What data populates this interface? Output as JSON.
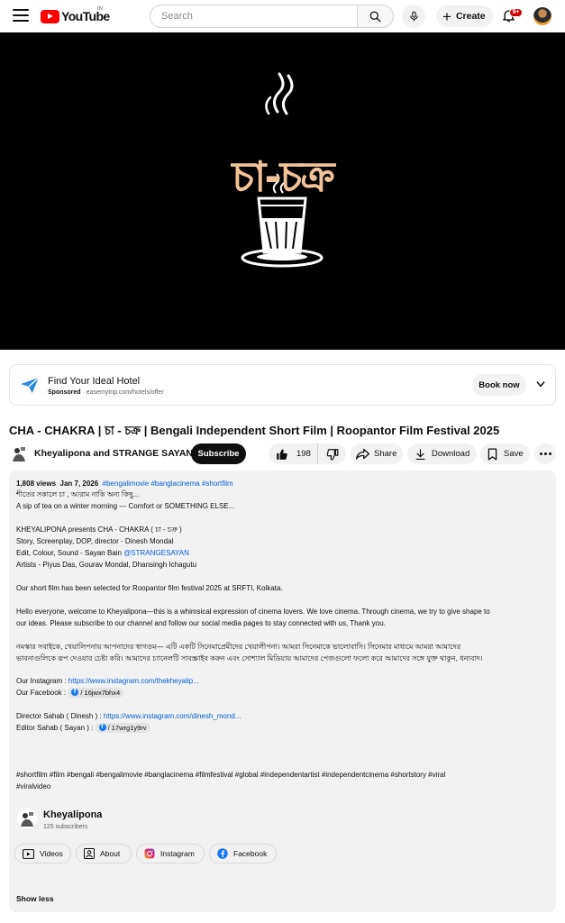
{
  "header": {
    "logo_text": "YouTube",
    "country_code": "IN",
    "search_placeholder": "Search",
    "create_label": "Create",
    "notification_count": "9+"
  },
  "player": {
    "poster_title": "চা-চক্র"
  },
  "ad": {
    "title": "Find Your Ideal Hotel",
    "sponsored_label": "Sponsored",
    "separator": " · ",
    "url": "easemytrip.com/hotels/offer",
    "cta": "Book now"
  },
  "video": {
    "title": "CHA - CHAKRA | চা - চক্র | Bengali Independent Short Film | Roopantor Film Festival 2025",
    "channel": "Kheyalipona and STRANGE SAYAN",
    "subscribe": "Subscribe",
    "likes": "198",
    "share": "Share",
    "download": "Download",
    "save": "Save"
  },
  "description": {
    "views": "1,808 views",
    "date": "Jan 7, 2026",
    "top_tags": "#bengalimovie #banglacinema #shortfilm",
    "line1": "শীতের সকালে চা , আরাম নাকি অন্য কিছু...",
    "line2": "A sip of tea on a winter morning --- Comfort or SOMETHING ELSE...",
    "line3": "KHEYALIPONA presents CHA - CHAKRA ( চা - চক্র )",
    "line4": "Story, Screenplay, DOP, director - Dinesh Mondal",
    "line5_prefix": "Edit, Colour, Sound - Sayan Bain ",
    "line5_mention": "@STRANGESAYAN",
    "line6": "Artists - Piyus Das, Gourav Mondal, Dhansingh Ichagutu",
    "line7": "Our short film has been selected for Roopantor film festival 2025 at SRFTI, Kolkata.",
    "line8": "Hello everyone, welcome to Kheyalipona—this is a whimsical expression of cinema lovers. We love cinema. Through cinema, we try to give shape to",
    "line9": "our ideas. Please subscribe to our channel and follow our social media pages to stay connected with us, Thank you.",
    "line10": "নমস্কার সবাইকে, খেয়ালিপনায় আপনাদের স্বাগতম— এটি একটি সিনেমাপ্রেমীদের খেয়ালীপনা। আমরা সিনেমাকে ভালোবাসি। সিনেমার মাধ্যমে আমরা আমাদের",
    "line11": "ভাবনাগুলিকে রূপ দেওয়ার চেষ্টা করি। আমাদের চ্যানেলটি সাবস্ক্রাইব করুন এবং সোশ্যাল মিডিয়ায় আমাদের পেজগুলো ফলো করে আমাদের সঙ্গে যুক্ত থাকুন, ধন্যবাদ।",
    "instagram_label": "Our Instagram : ",
    "instagram_link": "https://www.instagram.com/thekheyalip...",
    "facebook_label": "Our Facebook : ",
    "facebook_chip": "/ 16jwx7bhx4",
    "director_label": "Director Sahab ( Dinesh ) : ",
    "director_link": "https://www.instagram.com/dinesh_mond...",
    "editor_label": "Editor Sahab ( Sayan ) : ",
    "editor_chip": "/ 17wrg1y9rv",
    "bottom_tags1": "#shortfilm #film #bengali #bengalimovie #banglacinema #filmfestival #global #independentartist #independentcinema #shortstory #viral",
    "bottom_tags2": "#viralvideo",
    "about_channel": "Kheyalipona",
    "about_subscribers": "125 subscribers",
    "btn_videos": "Videos",
    "btn_about": "About",
    "btn_instagram": "Instagram",
    "btn_facebook": "Facebook",
    "show_less": "Show less"
  }
}
